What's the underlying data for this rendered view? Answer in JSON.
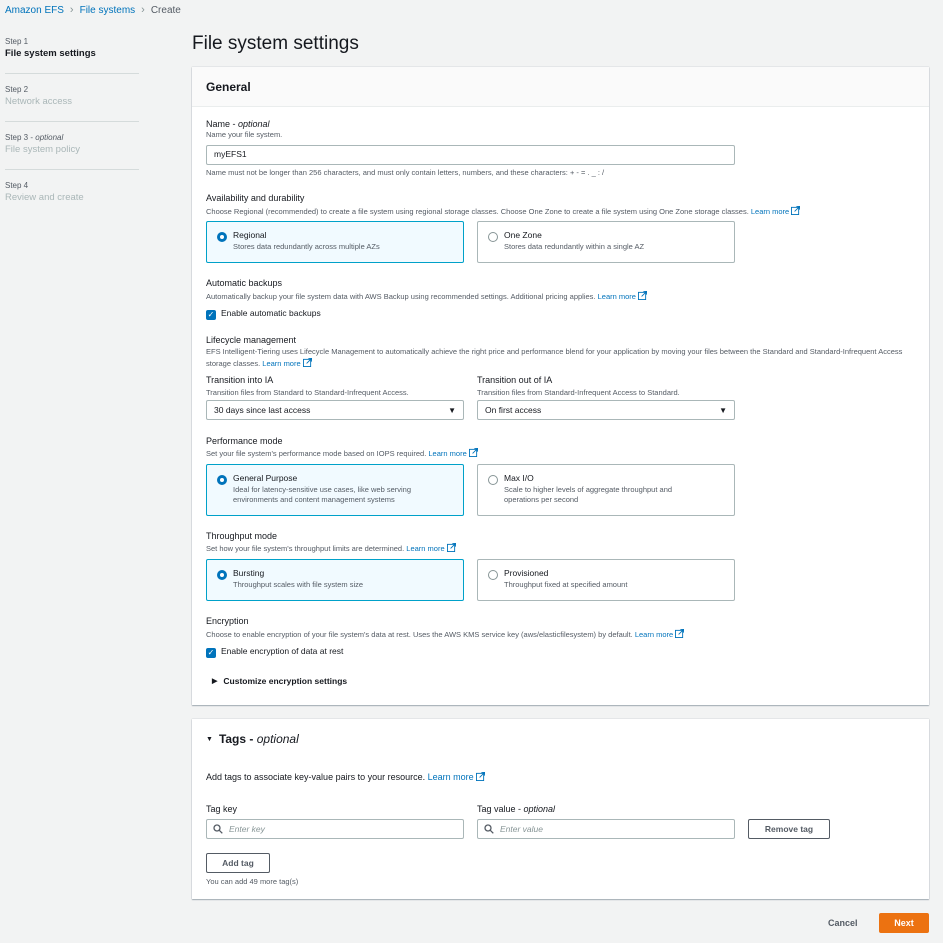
{
  "breadcrumb": {
    "root": "Amazon EFS",
    "parent": "File systems",
    "current": "Create"
  },
  "steps": [
    {
      "num": "Step 1",
      "name": "File system settings"
    },
    {
      "num": "Step 2",
      "name": "Network access"
    },
    {
      "num": "Step 3 - ",
      "num_optional": "optional",
      "name": "File system policy"
    },
    {
      "num": "Step 4",
      "name": "Review and create"
    }
  ],
  "page_title": "File system settings",
  "general": {
    "header": "General",
    "name": {
      "label": "Name - ",
      "label_optional": "optional",
      "desc": "Name your file system.",
      "value": "myEFS1",
      "constraint": "Name must not be longer than 256 characters, and must only contain letters, numbers, and these characters: + - = . _ : /"
    },
    "availability": {
      "label": "Availability and durability",
      "desc": "Choose Regional (recommended) to create a file system using regional storage classes. Choose One Zone to create a file system using One Zone storage classes.",
      "learn_more": "Learn more",
      "options": [
        {
          "title": "Regional",
          "desc": "Stores data redundantly across multiple AZs"
        },
        {
          "title": "One Zone",
          "desc": "Stores data redundantly within a single AZ"
        }
      ]
    },
    "backups": {
      "label": "Automatic backups",
      "desc": "Automatically backup your file system data with AWS Backup using recommended settings. Additional pricing applies.",
      "learn_more": "Learn more",
      "checkbox": "Enable automatic backups"
    },
    "lifecycle": {
      "label": "Lifecycle management",
      "desc": "EFS Intelligent-Tiering uses Lifecycle Management to automatically achieve the right price and performance blend for your application by moving your files between the Standard and Standard-Infrequent Access storage classes.",
      "learn_more": "Learn more",
      "into_ia": {
        "label": "Transition into IA",
        "desc": "Transition files from Standard to Standard-Infrequent Access.",
        "value": "30 days since last access"
      },
      "out_of_ia": {
        "label": "Transition out of IA",
        "desc": "Transition files from Standard-Infrequent Access to Standard.",
        "value": "On first access"
      }
    },
    "performance": {
      "label": "Performance mode",
      "desc": "Set your file system's performance mode based on IOPS required.",
      "learn_more": "Learn more",
      "options": [
        {
          "title": "General Purpose",
          "desc": "Ideal for latency-sensitive use cases, like web serving environments and content management systems"
        },
        {
          "title": "Max I/O",
          "desc": "Scale to higher levels of aggregate throughput and operations per second"
        }
      ]
    },
    "throughput": {
      "label": "Throughput mode",
      "desc": "Set how your file system's throughput limits are determined.",
      "learn_more": "Learn more",
      "options": [
        {
          "title": "Bursting",
          "desc": "Throughput scales with file system size"
        },
        {
          "title": "Provisioned",
          "desc": "Throughput fixed at specified amount"
        }
      ]
    },
    "encryption": {
      "label": "Encryption",
      "desc": "Choose to enable encryption of your file system's data at rest. Uses the AWS KMS service key (aws/elasticfilesystem) by default.",
      "learn_more": "Learn more",
      "checkbox": "Enable encryption of data at rest",
      "customize": "Customize encryption settings"
    }
  },
  "tags": {
    "header": "Tags - ",
    "header_optional": "optional",
    "desc": "Add tags to associate key-value pairs to your resource.",
    "learn_more": "Learn more",
    "key_label": "Tag key",
    "value_label": "Tag value - ",
    "value_optional": "optional",
    "key_placeholder": "Enter key",
    "value_placeholder": "Enter value",
    "remove_button": "Remove tag",
    "add_button": "Add tag",
    "remaining": "You can add 49 more tag(s)"
  },
  "footer": {
    "cancel": "Cancel",
    "next": "Next"
  },
  "colors": {
    "link": "#0073bb",
    "primary": "#ec7211",
    "selected_border": "#00a1c9"
  }
}
